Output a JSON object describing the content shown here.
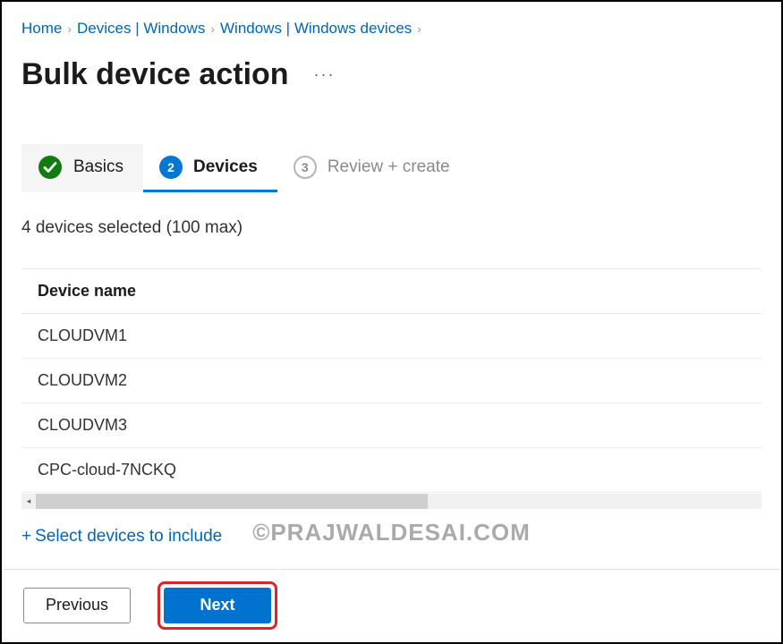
{
  "breadcrumbs": {
    "items": [
      {
        "label": "Home"
      },
      {
        "label": "Devices | Windows"
      },
      {
        "label": "Windows | Windows devices"
      }
    ]
  },
  "page": {
    "title": "Bulk device action"
  },
  "stepper": {
    "completed": {
      "label": "Basics"
    },
    "current": {
      "num": "2",
      "label": "Devices"
    },
    "upcoming": {
      "num": "3",
      "label": "Review + create"
    }
  },
  "devices": {
    "selected_summary": "4 devices selected (100 max)",
    "column_header": "Device name",
    "rows": [
      "CLOUDVM1",
      "CLOUDVM2",
      "CLOUDVM3",
      "CPC-cloud-7NCKQ"
    ],
    "add_link_prefix": "+",
    "add_link_label": "Select devices to include"
  },
  "footer": {
    "previous": "Previous",
    "next": "Next"
  },
  "watermark": "©PRAJWALDESAI.COM",
  "colors": {
    "link": "#0066b8",
    "primary": "#0078d4",
    "highlight_border": "#e02424",
    "success": "#107c10"
  }
}
